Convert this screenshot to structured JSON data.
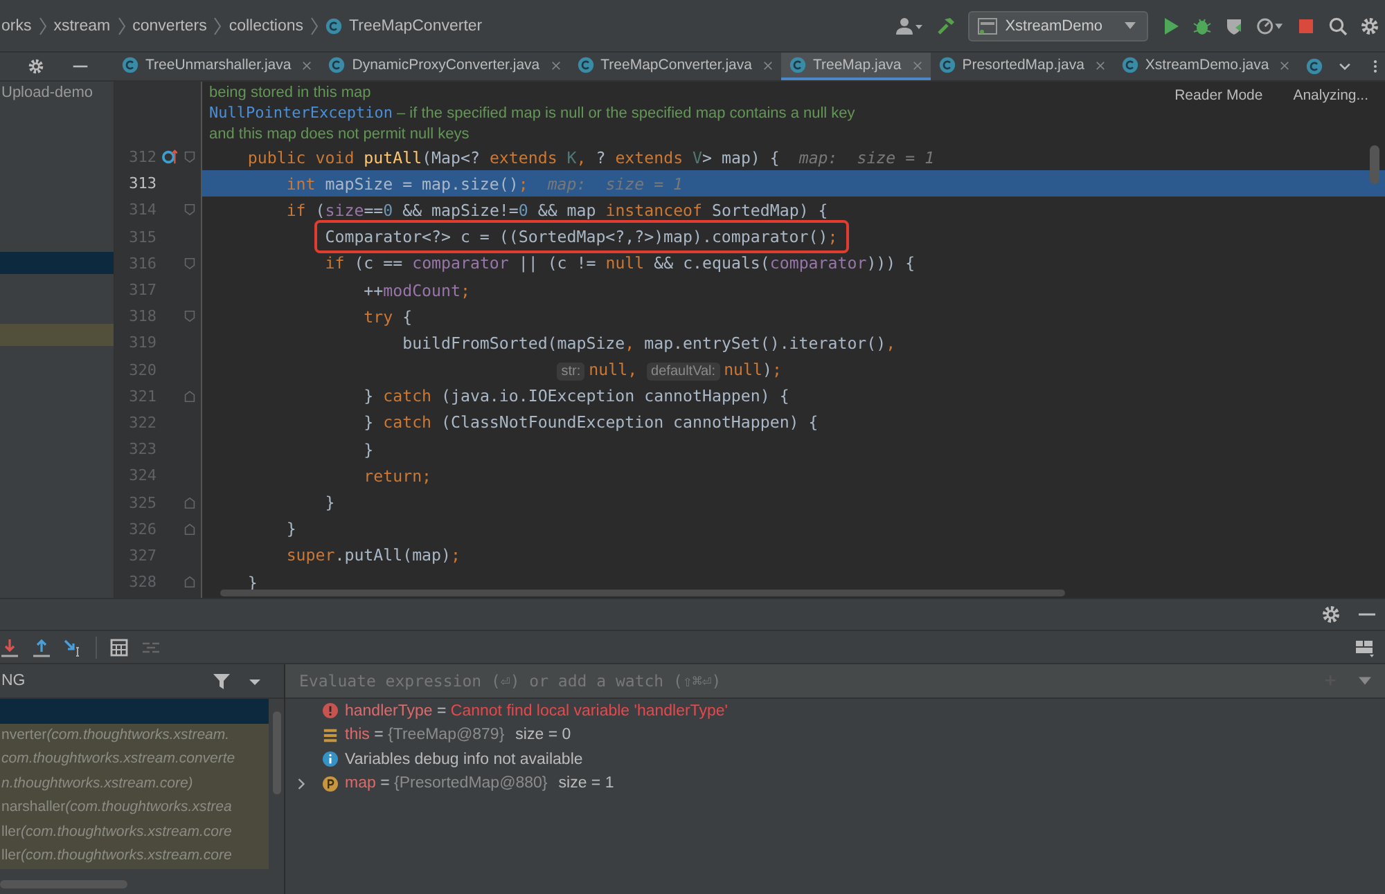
{
  "breadcrumbs": [
    {
      "label": "orks"
    },
    {
      "label": "xstream"
    },
    {
      "label": "converters"
    },
    {
      "label": "collections"
    },
    {
      "label": "TreeMapConverter"
    }
  ],
  "run_config": {
    "label": "XstreamDemo"
  },
  "tabs": [
    {
      "label": "TreeUnmarshaller.java",
      "selected": false
    },
    {
      "label": "DynamicProxyConverter.java",
      "selected": false
    },
    {
      "label": "TreeMapConverter.java",
      "selected": false
    },
    {
      "label": "TreeMap.java",
      "selected": true
    },
    {
      "label": "PresortedMap.java",
      "selected": false
    },
    {
      "label": "XstreamDemo.java",
      "selected": false
    }
  ],
  "sidebar": {
    "project": "Upload-demo",
    "rows": [
      {
        "selected": true
      },
      {
        "selected": false
      }
    ]
  },
  "editor": {
    "reader_mode": "Reader Mode",
    "status": "Analyzing...",
    "javadoc": [
      [
        {
          "kind": "doc",
          "text": "being stored in this map"
        }
      ],
      [
        {
          "kind": "doclink",
          "text": "NullPointerException"
        },
        {
          "kind": "doc",
          "text": " – if the specified map is null or the specified map contains a null key"
        }
      ],
      [
        {
          "kind": "doc",
          "text": "and this map does not permit null keys"
        }
      ]
    ],
    "lines": [
      {
        "number": "312",
        "selected": false,
        "overridden": true,
        "fold_start": true,
        "fold_end": false,
        "boxed": false,
        "tokens": [
          {
            "kind": "kw",
            "text": "    public void "
          },
          {
            "kind": "method",
            "text": "putAll"
          },
          {
            "kind": "plain",
            "text": "(Map<? "
          },
          {
            "kind": "kw",
            "text": "extends "
          },
          {
            "kind": "type",
            "text": "K"
          },
          {
            "kind": "kw",
            "text": ", "
          },
          {
            "kind": "plain",
            "text": "? "
          },
          {
            "kind": "kw",
            "text": "extends "
          },
          {
            "kind": "type",
            "text": "V"
          },
          {
            "kind": "plain",
            "text": "> map) {  "
          },
          {
            "kind": "hint",
            "text": "map:  size = 1"
          }
        ]
      },
      {
        "number": "313",
        "selected": true,
        "overridden": false,
        "fold_start": false,
        "fold_end": false,
        "boxed": false,
        "tokens": [
          {
            "kind": "kw",
            "text": "        int "
          },
          {
            "kind": "plain",
            "text": "mapSize = map.size()"
          },
          {
            "kind": "kw",
            "text": ";  "
          },
          {
            "kind": "hint",
            "text": "map:  size = 1"
          }
        ]
      },
      {
        "number": "314",
        "selected": false,
        "overridden": false,
        "fold_start": true,
        "fold_end": false,
        "boxed": false,
        "tokens": [
          {
            "kind": "kw",
            "text": "        if "
          },
          {
            "kind": "plain",
            "text": "("
          },
          {
            "kind": "field",
            "text": "size"
          },
          {
            "kind": "plain",
            "text": "=="
          },
          {
            "kind": "num",
            "text": "0"
          },
          {
            "kind": "plain",
            "text": " && mapSize!="
          },
          {
            "kind": "num",
            "text": "0"
          },
          {
            "kind": "plain",
            "text": " && map "
          },
          {
            "kind": "kw",
            "text": "instanceof "
          },
          {
            "kind": "plain",
            "text": "SortedMap) {"
          }
        ]
      },
      {
        "number": "315",
        "selected": false,
        "overridden": false,
        "fold_start": false,
        "fold_end": false,
        "boxed": true,
        "tokens": [
          {
            "kind": "plain",
            "text": "            Comparator<?> c = ((SortedMap<?,?>)map).comparator()"
          },
          {
            "kind": "kw",
            "text": ";"
          }
        ]
      },
      {
        "number": "316",
        "selected": false,
        "overridden": false,
        "fold_start": true,
        "fold_end": false,
        "boxed": false,
        "tokens": [
          {
            "kind": "kw",
            "text": "            if "
          },
          {
            "kind": "plain",
            "text": "(c == "
          },
          {
            "kind": "field",
            "text": "comparator"
          },
          {
            "kind": "plain",
            "text": " || (c != "
          },
          {
            "kind": "kw",
            "text": "null "
          },
          {
            "kind": "plain",
            "text": "&& c.equals("
          },
          {
            "kind": "field",
            "text": "comparator"
          },
          {
            "kind": "plain",
            "text": "))) {"
          }
        ]
      },
      {
        "number": "317",
        "selected": false,
        "overridden": false,
        "fold_start": false,
        "fold_end": false,
        "boxed": false,
        "tokens": [
          {
            "kind": "plain",
            "text": "                ++"
          },
          {
            "kind": "field",
            "text": "modCount"
          },
          {
            "kind": "kw",
            "text": ";"
          }
        ]
      },
      {
        "number": "318",
        "selected": false,
        "overridden": false,
        "fold_start": true,
        "fold_end": false,
        "boxed": false,
        "tokens": [
          {
            "kind": "kw",
            "text": "                try "
          },
          {
            "kind": "plain",
            "text": "{"
          }
        ]
      },
      {
        "number": "319",
        "selected": false,
        "overridden": false,
        "fold_start": false,
        "fold_end": false,
        "boxed": false,
        "tokens": [
          {
            "kind": "plain",
            "text": "                    buildFromSorted(mapSize"
          },
          {
            "kind": "kw",
            "text": ", "
          },
          {
            "kind": "plain",
            "text": "map.entrySet().iterator()"
          },
          {
            "kind": "kw",
            "text": ","
          }
        ]
      },
      {
        "number": "320",
        "selected": false,
        "overridden": false,
        "fold_start": false,
        "fold_end": false,
        "boxed": false,
        "tokens": [
          {
            "kind": "inlay",
            "text": "str:"
          },
          {
            "kind": "kw",
            "text": "null, "
          },
          {
            "kind": "inlay",
            "text": "defaultVal:"
          },
          {
            "kind": "kw",
            "text": "null"
          },
          {
            "kind": "plain",
            "text": ")"
          },
          {
            "kind": "kw",
            "text": ";"
          }
        ]
      },
      {
        "number": "321",
        "selected": false,
        "overridden": false,
        "fold_start": false,
        "fold_end": true,
        "boxed": false,
        "tokens": [
          {
            "kind": "plain",
            "text": "                } "
          },
          {
            "kind": "kw",
            "text": "catch "
          },
          {
            "kind": "plain",
            "text": "(java.io.IOException cannotHappen) {"
          }
        ]
      },
      {
        "number": "322",
        "selected": false,
        "overridden": false,
        "fold_start": false,
        "fold_end": false,
        "boxed": false,
        "tokens": [
          {
            "kind": "plain",
            "text": "                } "
          },
          {
            "kind": "kw",
            "text": "catch "
          },
          {
            "kind": "plain",
            "text": "(ClassNotFoundException cannotHappen) {"
          }
        ]
      },
      {
        "number": "323",
        "selected": false,
        "overridden": false,
        "fold_start": false,
        "fold_end": false,
        "boxed": false,
        "tokens": [
          {
            "kind": "plain",
            "text": "                }"
          }
        ]
      },
      {
        "number": "324",
        "selected": false,
        "overridden": false,
        "fold_start": false,
        "fold_end": false,
        "boxed": false,
        "tokens": [
          {
            "kind": "kw",
            "text": "                return;"
          }
        ]
      },
      {
        "number": "325",
        "selected": false,
        "overridden": false,
        "fold_start": false,
        "fold_end": true,
        "boxed": false,
        "tokens": [
          {
            "kind": "plain",
            "text": "            }"
          }
        ]
      },
      {
        "number": "326",
        "selected": false,
        "overridden": false,
        "fold_start": false,
        "fold_end": true,
        "boxed": false,
        "tokens": [
          {
            "kind": "plain",
            "text": "        }"
          }
        ]
      },
      {
        "number": "327",
        "selected": false,
        "overridden": false,
        "fold_start": false,
        "fold_end": false,
        "boxed": false,
        "tokens": [
          {
            "kind": "kw",
            "text": "        super"
          },
          {
            "kind": "plain",
            "text": ".putAll(map)"
          },
          {
            "kind": "kw",
            "text": ";"
          }
        ]
      },
      {
        "number": "328",
        "selected": false,
        "overridden": false,
        "fold_start": false,
        "fold_end": true,
        "boxed": false,
        "tokens": [
          {
            "kind": "plain",
            "text": "    }"
          }
        ]
      }
    ]
  },
  "debugger": {
    "frames_header": "NG",
    "frames": [
      {
        "selected": true
      },
      {
        "selected": false,
        "method": "nverter",
        "location": "(com.thoughtworks.xstream."
      },
      {
        "selected": false,
        "location": "com.thoughtworks.xstream.converte"
      },
      {
        "selected": false,
        "location": "n.thoughtworks.xstream.core)"
      },
      {
        "selected": false,
        "method": "narshaller",
        "location": "(com.thoughtworks.xstrea"
      },
      {
        "selected": false,
        "method": "ller",
        "location": "(com.thoughtworks.xstream.core"
      },
      {
        "selected": false,
        "method": "ller",
        "location": "(com.thoughtworks.xstream.core"
      }
    ],
    "evaluate": {
      "placeholder": "Evaluate expression (⏎) or add a watch (⇧⌘⏎)"
    },
    "variables": [
      {
        "kind": "error",
        "expandable": false,
        "name": "handlerType",
        "separator": "=",
        "value": "Cannot find local variable 'handlerType'"
      },
      {
        "kind": "field",
        "expandable": false,
        "name": "this",
        "separator": "=",
        "value": "{TreeMap@879}",
        "extra": "size = 0"
      },
      {
        "kind": "info",
        "expandable": false,
        "text": "Variables debug info not available"
      },
      {
        "kind": "param",
        "expandable": true,
        "name": "map",
        "separator": "=",
        "value": "{PresortedMap@880}",
        "extra": "size = 1"
      }
    ]
  }
}
